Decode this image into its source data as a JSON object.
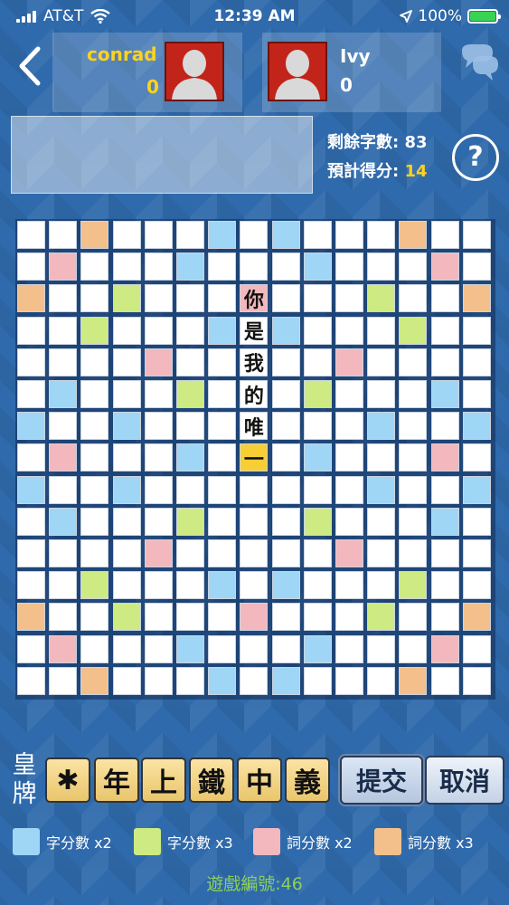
{
  "status_bar": {
    "carrier": "AT&T",
    "time": "12:39 AM",
    "battery": "100%",
    "battery_level": 1.0
  },
  "players": [
    {
      "name": "conrad",
      "score": "0",
      "name_color": "#ffd21f",
      "score_color": "#ffd21f"
    },
    {
      "name": "Ivy",
      "score": "0",
      "name_color": "#ffffff",
      "score_color": "#ffffff"
    }
  ],
  "stats": {
    "remaining_label": "剩餘字數:",
    "remaining_value": "83",
    "projected_label": "預計得分:",
    "projected_value": "14"
  },
  "help_label": "?",
  "board": {
    "size": 15,
    "rows": [
      "nnonnnbnbnnnonn",
      "npnnnbnnnbnnnpn",
      "onngnnnpnnngnno",
      "nngnnnbnbnnngnn",
      "nnnnpnnnnnpnnnn",
      "nbnnngnnngnnnbn",
      "bnnbnnnnnnnbnnb",
      "npnnnbnnnbnnnpn",
      "bnnbnnnnnnnbnnb",
      "nbnnngnnngnnnbn",
      "nnnnpnnnnnpnnnn",
      "nngnnnbnbnnngnn",
      "onngnnnpnnngnno",
      "npnnnbnnnbnnnpn",
      "nnonnnbnbnnnonn"
    ],
    "tiles": [
      {
        "row": 2,
        "col": 7,
        "char": "你"
      },
      {
        "row": 3,
        "col": 7,
        "char": "是"
      },
      {
        "row": 4,
        "col": 7,
        "char": "我"
      },
      {
        "row": 5,
        "col": 7,
        "char": "的"
      },
      {
        "row": 6,
        "col": 7,
        "char": "唯"
      },
      {
        "row": 7,
        "col": 7,
        "char": "一",
        "highlight": true
      }
    ]
  },
  "rack": {
    "label_line1": "皇",
    "label_line2": "牌",
    "tiles": [
      "✱",
      "年",
      "上",
      "鐵",
      "中",
      "義"
    ]
  },
  "buttons": {
    "submit": "提交",
    "cancel": "取消"
  },
  "legend": [
    {
      "label": "字分數 x2",
      "color": "#9fd6f5"
    },
    {
      "label": "字分數 x3",
      "color": "#cdeb82"
    },
    {
      "label": "詞分數 x2",
      "color": "#f2b8bd"
    },
    {
      "label": "詞分數 x3",
      "color": "#f3c08c"
    }
  ],
  "game_id": "遊戲編號:46",
  "colors": {
    "background": "#2f6aac",
    "accent": "#ffd21f",
    "tile_highlight": "#f7cf35",
    "game_id": "#8bd05b"
  }
}
